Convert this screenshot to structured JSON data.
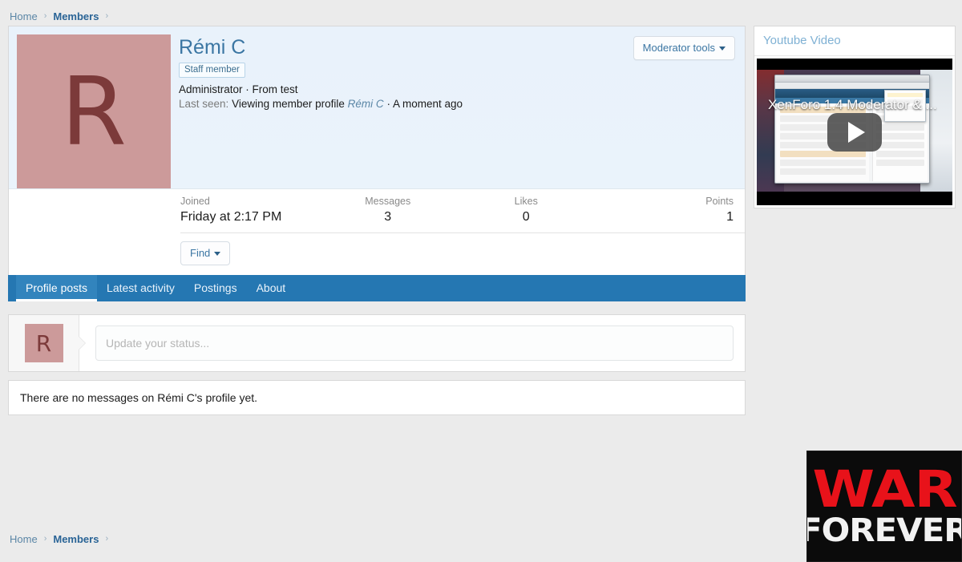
{
  "breadcrumb": {
    "home": "Home",
    "members": "Members",
    "separator": "›"
  },
  "member": {
    "name": "Rémi C",
    "avatar_initial": "R",
    "avatar_color": "#cc9a9a",
    "avatar_text_color": "#7c3a3a",
    "staff_badge": "Staff member",
    "user_title": "Administrator · From test",
    "last_seen_label": "Last seen:",
    "last_seen_action": "Viewing member profile",
    "last_seen_link": "Rémi C",
    "last_seen_separator": "·",
    "last_seen_time": "A moment ago",
    "moderator_tools": "Moderator tools",
    "find_button": "Find",
    "stats": [
      {
        "label": "Joined",
        "value": "Friday at 2:17 PM"
      },
      {
        "label": "Messages",
        "value": "3"
      },
      {
        "label": "Likes",
        "value": "0"
      },
      {
        "label": "Points",
        "value": "1"
      }
    ]
  },
  "tabs": [
    {
      "label": "Profile posts",
      "active": true
    },
    {
      "label": "Latest activity",
      "active": false
    },
    {
      "label": "Postings",
      "active": false
    },
    {
      "label": "About",
      "active": false
    }
  ],
  "status_update": {
    "avatar_initial": "R",
    "placeholder": "Update your status...",
    "value": ""
  },
  "empty_state": {
    "message": "There are no messages on Rémi C's profile yet."
  },
  "sidebar": {
    "widget_title": "Youtube Video",
    "video_title": "XenForo 1.4 Moderator & ...",
    "play_icon": "play-icon"
  },
  "banner": {
    "line1": "WAR",
    "line2": "FOREVER",
    "line1_color": "#e8121a",
    "line2_color": "#f2f2f2",
    "background": "#0b0b0b"
  },
  "theme": {
    "accent": "#2577b2",
    "header_bg": "#eaf3fb",
    "page_bg": "#ebebeb",
    "link": "#5b86a6"
  }
}
